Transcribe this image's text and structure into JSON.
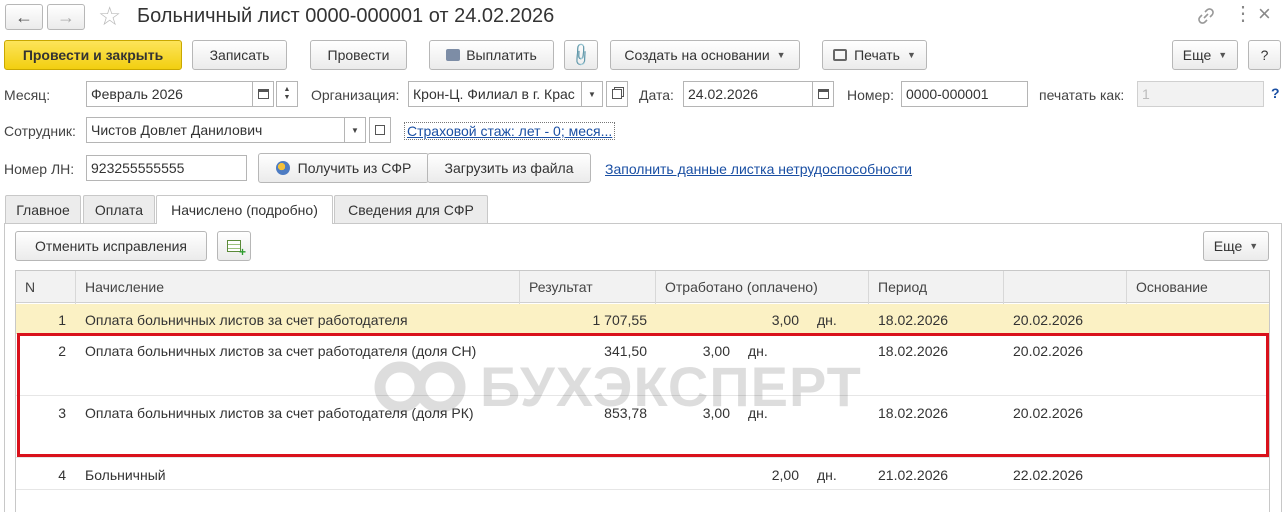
{
  "window": {
    "title": "Больничный лист 0000-000001 от 24.02.2026"
  },
  "toolbar": {
    "post_and_close": "Провести и закрыть",
    "save": "Записать",
    "post": "Провести",
    "pay": "Выплатить",
    "create_based_on": "Создать на основании",
    "print": "Печать",
    "more": "Еще",
    "help": "?"
  },
  "form": {
    "month_label": "Месяц:",
    "month_value": "Февраль 2026",
    "org_label": "Организация:",
    "org_value": "Крон-Ц. Филиал в г. Крас",
    "date_label": "Дата:",
    "date_value": "24.02.2026",
    "number_label": "Номер:",
    "number_value": "0000-000001",
    "print_as_label": "печатать как:",
    "print_as_value": "1",
    "help_mark": "?",
    "employee_label": "Сотрудник:",
    "employee_value": "Чистов Довлет Данилович",
    "insurance_link": "Страховой стаж: лет - 0; меся...",
    "ln_label": "Номер ЛН:",
    "ln_value": "923255555555",
    "get_from_sfr": "Получить из СФР",
    "load_from_file": "Загрузить из файла",
    "fill_link": "Заполнить данные листка нетрудоспособности"
  },
  "tabs": [
    "Главное",
    "Оплата",
    "Начислено (подробно)",
    "Сведения для СФР"
  ],
  "tab_toolbar": {
    "cancel_fixes": "Отменить исправления",
    "more": "Еще"
  },
  "table": {
    "headers": {
      "n": "N",
      "accrual": "Начисление",
      "result": "Результат",
      "worked": "Отработано (оплачено)",
      "period": "Период",
      "basis": "Основание"
    },
    "rows": [
      {
        "n": "1",
        "accrual": "Оплата больничных листов за счет работодателя",
        "result": "1 707,55",
        "worked": "3,00",
        "unit": "дн.",
        "from": "18.02.2026",
        "to": "20.02.2026"
      },
      {
        "n": "2",
        "accrual": "Оплата больничных листов за счет работодателя (доля СН)",
        "result": "341,50",
        "worked": "3,00",
        "unit": "дн.",
        "from": "18.02.2026",
        "to": "20.02.2026"
      },
      {
        "n": "3",
        "accrual": "Оплата больничных листов за счет работодателя (доля РК)",
        "result": "853,78",
        "worked": "3,00",
        "unit": "дн.",
        "from": "18.02.2026",
        "to": "20.02.2026"
      },
      {
        "n": "4",
        "accrual": "Больничный",
        "result": "",
        "worked": "2,00",
        "unit": "дн.",
        "from": "21.02.2026",
        "to": "22.02.2026"
      }
    ]
  },
  "watermark": "БУХЭКСПЕРТ",
  "colors": {
    "primary_button": "#f8d81c",
    "selected_row": "#fbf1c4",
    "highlight_box": "#d9111b",
    "link": "#1a4fa3"
  }
}
